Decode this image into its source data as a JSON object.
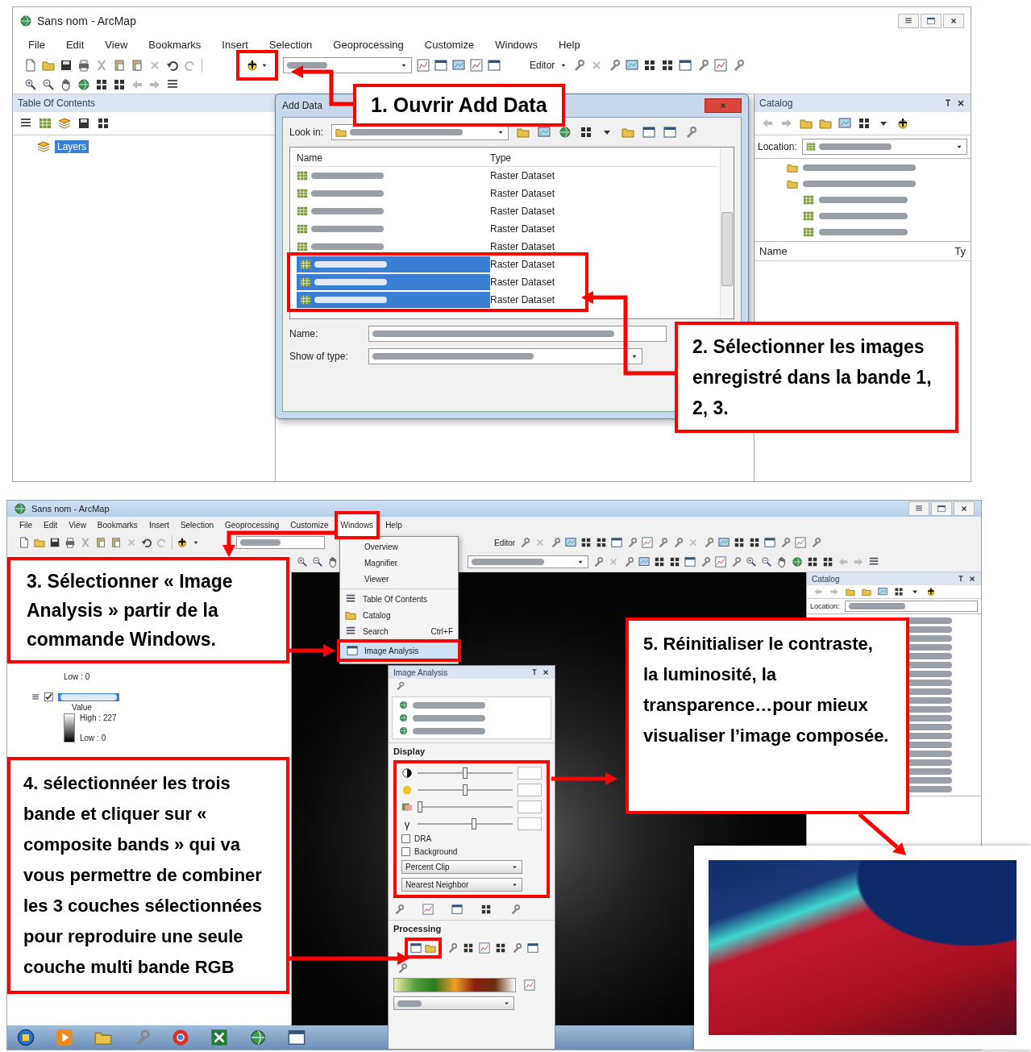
{
  "top_screenshot": {
    "window_title": "Sans nom - ArcMap",
    "menu": [
      {
        "label": "File",
        "selected": false
      },
      {
        "label": "Edit",
        "selected": false
      },
      {
        "label": "View",
        "selected": false
      },
      {
        "label": "Bookmarks",
        "selected": false
      },
      {
        "label": "Insert",
        "selected": false
      },
      {
        "label": "Selection",
        "selected": false
      },
      {
        "label": "Geoprocessing",
        "selected": false
      },
      {
        "label": "Customize",
        "selected": false
      },
      {
        "label": "Windows",
        "selected": false
      },
      {
        "label": "Help",
        "selected": false
      }
    ],
    "editor_menu": "Editor",
    "toc": {
      "title": "Table Of Contents",
      "items": [
        {
          "label": "Layers",
          "selected": true
        }
      ]
    },
    "add_data": {
      "title": "Add Data",
      "look_in_label": "Look in:",
      "columns": [
        "Name",
        "Type"
      ],
      "rows": [
        {
          "type": "Raster Dataset",
          "selected": false
        },
        {
          "type": "Raster Dataset",
          "selected": false
        },
        {
          "type": "Raster Dataset",
          "selected": false
        },
        {
          "type": "Raster Dataset",
          "selected": false
        },
        {
          "type": "Raster Dataset",
          "selected": false
        },
        {
          "type": "Raster Dataset",
          "selected": true
        },
        {
          "type": "Raster Dataset",
          "selected": true
        },
        {
          "type": "Raster Dataset",
          "selected": true
        }
      ],
      "name_label": "Name:",
      "show_type_label": "Show of type:"
    },
    "catalog": {
      "title": "Catalog",
      "location_label": "Location:",
      "columns": [
        "Name",
        "Ty"
      ]
    }
  },
  "bottom_screenshot": {
    "window_title": "Sans nom - ArcMap",
    "menu": [
      {
        "label": "File",
        "selected": false
      },
      {
        "label": "Edit",
        "selected": false
      },
      {
        "label": "View",
        "selected": false
      },
      {
        "label": "Bookmarks",
        "selected": false
      },
      {
        "label": "Insert",
        "selected": false
      },
      {
        "label": "Selection",
        "selected": false
      },
      {
        "label": "Geoprocessing",
        "selected": false
      },
      {
        "label": "Customize",
        "selected": false
      },
      {
        "label": "Windows",
        "selected": true
      },
      {
        "label": "Help",
        "selected": false
      }
    ],
    "editor_menu": "Editor",
    "windows_menu": [
      {
        "label": "Overview",
        "selected": false
      },
      {
        "label": "Magnifier",
        "selected": false
      },
      {
        "label": "Viewer",
        "selected": false
      },
      {
        "label": "Table Of Contents",
        "selected": false
      },
      {
        "label": "Catalog",
        "selected": false
      },
      {
        "label": "Search",
        "shortcut": "Ctrl+F",
        "selected": false
      },
      {
        "label": "Image Analysis",
        "selected": true
      }
    ],
    "toc": {
      "low_top": "Low : 0",
      "layer_checked": true,
      "value_label": "Value",
      "high": "High : 227",
      "low": "Low : 0"
    },
    "image_analysis": {
      "title": "Image Analysis",
      "display_title": "Display",
      "sliders": [
        {
          "kind": "contrast",
          "level": 0.5
        },
        {
          "kind": "brightness",
          "level": 0.5
        },
        {
          "kind": "transparency",
          "level": 0
        },
        {
          "kind": "gamma",
          "symbol": "γ",
          "level": 0.6
        }
      ],
      "checkboxes": [
        {
          "label": "DRA",
          "checked": false
        },
        {
          "label": "Background",
          "checked": false
        }
      ],
      "dropdowns": [
        "Percent Clip",
        "Nearest Neighbor"
      ],
      "processing_title": "Processing"
    },
    "catalog": {
      "title": "Catalog",
      "location_label": "Location:"
    }
  },
  "callouts": [
    "1. Ouvrir Add Data",
    "2. Sélectionner les images enregistré dans la bande 1, 2, 3.",
    "3. Sélectionner « Image Analysis » partir de la commande Windows.",
    "4. sélectionnéer les trois bande et cliquer sur « composite bands » qui va vous permettre de combiner les 3 couches sélectionnées pour reproduire une seule couche multi bande RGB",
    "5. Réinitialiser le contraste, la luminosité, la transparence…pour mieux visualiser l’image composée."
  ]
}
